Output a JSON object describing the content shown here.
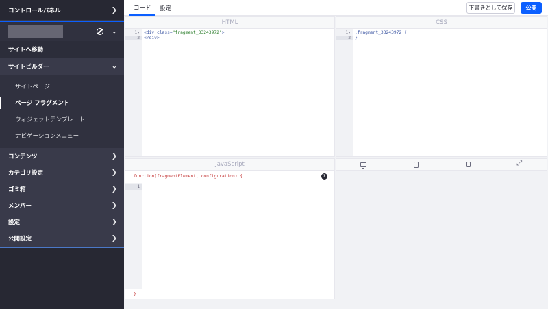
{
  "sidebar": {
    "control_panel": "コントロールパネル",
    "goto_site": "サイトへ移動",
    "site_builder": "サイトビルダー",
    "sub_items": [
      "サイトページ",
      "ページ フラグメント",
      "ウィジェットテンプレート",
      "ナビゲーションメニュー"
    ],
    "items": [
      "コンテンツ",
      "カテゴリ設定",
      "ゴミ箱",
      "メンバー",
      "設定",
      "公開設定"
    ]
  },
  "topbar": {
    "tab_code": "コード",
    "tab_settings": "設定",
    "save_draft": "下書きとして保存",
    "publish": "公開"
  },
  "editors": {
    "html_title": "HTML",
    "css_title": "CSS",
    "js_title": "JavaScript",
    "html_line1_open": "<div ",
    "html_line1_attr": "class=",
    "html_line1_str": "\"fragment_33243972\"",
    "html_line1_close": ">",
    "html_line2": "</div>",
    "css_line1": ".fragment_33243972 {",
    "css_line2": "}",
    "js_header": "function(fragmentElement, configuration) {",
    "js_footer": "}",
    "help_glyph": "?"
  },
  "line_numbers": {
    "one": "1",
    "two": "2"
  },
  "icons": {
    "fold": "▾",
    "chevron_right": "❯",
    "chevron_down": "⌄"
  }
}
